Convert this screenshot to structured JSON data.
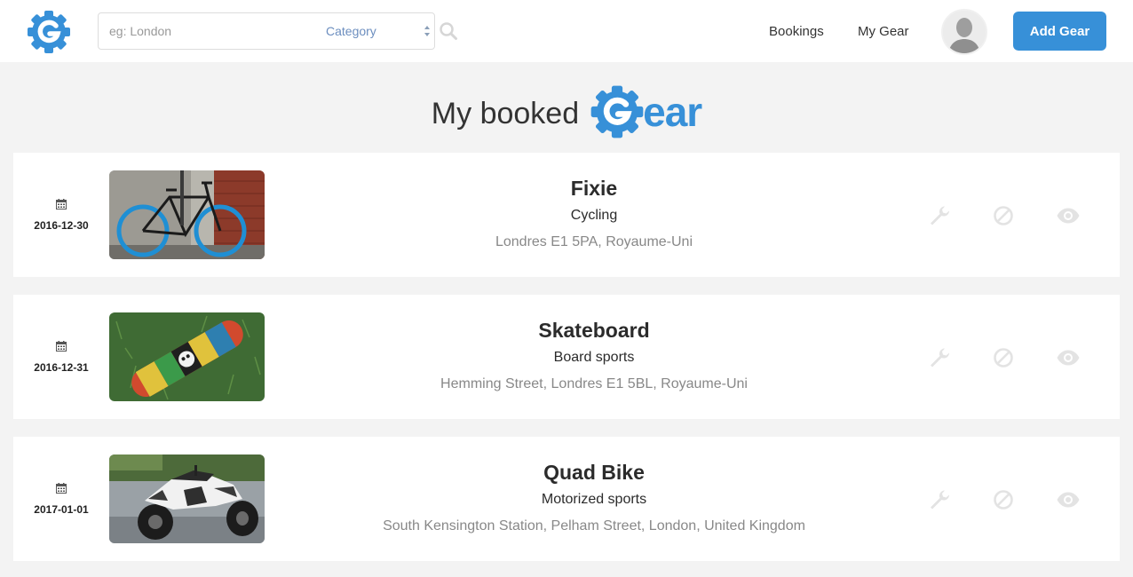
{
  "navbar": {
    "search_placeholder": "eg: London",
    "category_label": "Category",
    "links": {
      "bookings": "Bookings",
      "my_gear": "My Gear"
    },
    "add_gear_label": "Add Gear"
  },
  "heading": {
    "text": "My booked",
    "logo_letters": "ear"
  },
  "bookings": [
    {
      "date": "2016-12-30",
      "name": "Fixie",
      "category": "Cycling",
      "location": "Londres E1 5PA, Royaume-Uni",
      "image": "bicycle"
    },
    {
      "date": "2016-12-31",
      "name": "Skateboard",
      "category": "Board sports",
      "location": "Hemming Street, Londres E1 5BL, Royaume-Uni",
      "image": "skateboard"
    },
    {
      "date": "2017-01-01",
      "name": "Quad Bike",
      "category": "Motorized sports",
      "location": "South Kensington Station, Pelham Street, London, United Kingdom",
      "image": "quad-bike"
    }
  ],
  "colors": {
    "brand_blue": "#3790d8",
    "action_icon": "#e3e3e3",
    "page_bg": "#f3f3f3"
  },
  "icons": {
    "calendar": "calendar-icon",
    "edit": "wrench-icon",
    "cancel": "cancel-icon",
    "view": "eye-icon",
    "search": "search-icon"
  }
}
